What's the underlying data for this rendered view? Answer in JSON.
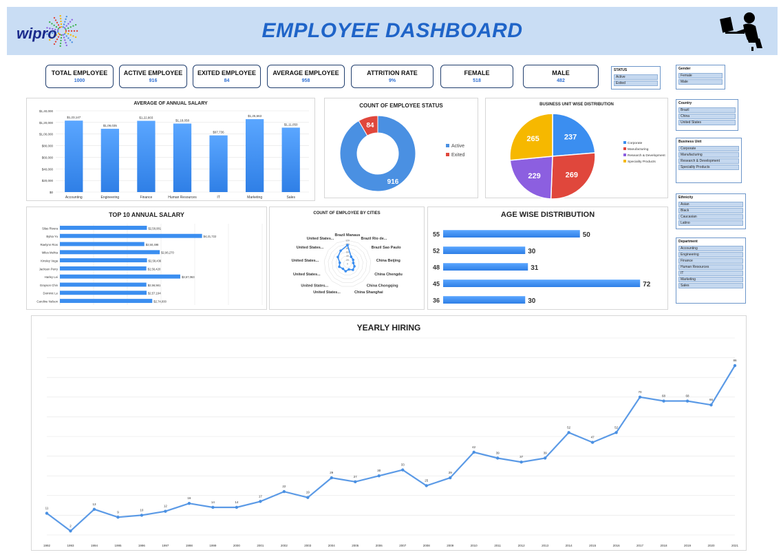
{
  "header": {
    "logo_text": "wipro",
    "title": "EMPLOYEE DASHBOARD"
  },
  "kpis": [
    {
      "label": "TOTAL EMPLOYEE",
      "value": "1000"
    },
    {
      "label": "ACTIVE EMPLOYEE",
      "value": "916"
    },
    {
      "label": "EXITED EMPLOYEE",
      "value": "84"
    },
    {
      "label": "AVERAGE EMPLOYEE",
      "value": "958"
    },
    {
      "label": "ATTRITION RATE",
      "value": "9%"
    },
    {
      "label": "FEMALE",
      "value": "518"
    },
    {
      "label": "MALE",
      "value": "482"
    }
  ],
  "slicers": {
    "status": {
      "title": "STATUS",
      "items": [
        "Active",
        "Exited"
      ]
    },
    "gender": {
      "title": "Gender",
      "items": [
        "Female",
        "Male"
      ]
    },
    "country": {
      "title": "Country",
      "items": [
        "Brazil",
        "China",
        "United States"
      ]
    },
    "business_unit": {
      "title": "Business Unit",
      "items": [
        "Corporate",
        "Manufacturing",
        "Research & Development",
        "Speciality Products"
      ]
    },
    "ethnicity": {
      "title": "Ethnicity",
      "items": [
        "Asian",
        "Black",
        "Caucasian",
        "Latino"
      ]
    },
    "department": {
      "title": "Department",
      "items": [
        "Accounting",
        "Engineering",
        "Finance",
        "Human Resources",
        "IT",
        "Marketing",
        "Sales"
      ]
    }
  },
  "colors": {
    "accent": "#3b8ef0",
    "active": "#4a90e2",
    "exited": "#e0473c",
    "purple": "#8c5fe0",
    "yellow": "#f6b800"
  },
  "chart_data": [
    {
      "type": "bar",
      "title": "AVERAGE OF ANNUAL SALARY",
      "categories": [
        "Accounting",
        "Engineering",
        "Finance",
        "Human Resources",
        "IT",
        "Marketing",
        "Sales"
      ],
      "values": [
        123147,
        109035,
        122803,
        118058,
        97736,
        125663,
        111050
      ],
      "value_labels": [
        "$1,23,147",
        "$1,09,035",
        "$1,22,803",
        "$1,18,058",
        "$97,736",
        "$1,25,663",
        "$1,11,050"
      ],
      "yticks": [
        "$0",
        "$20,000",
        "$40,000",
        "$60,000",
        "$80,000",
        "$1,00,000",
        "$1,20,000",
        "$1,40,000"
      ],
      "ylim": [
        0,
        140000
      ],
      "grid": true
    },
    {
      "type": "pie",
      "title": "COUNT OF EMPLOYEE STATUS",
      "labels": [
        "Active",
        "Exited"
      ],
      "values": [
        916,
        84
      ],
      "legend": "right"
    },
    {
      "type": "pie",
      "title": "BUSINESS UNIT WISE DISTRIBUTION",
      "labels": [
        "Corporate",
        "Manufacturing",
        "Research & Development",
        "Speciality Products"
      ],
      "values": [
        237,
        269,
        229,
        265
      ],
      "legend": "right"
    },
    {
      "type": "bar",
      "title": "TOP 10 ANNUAL SALARY",
      "categories": [
        "Silas Rivera",
        "Bylsa Yu",
        "Raelynn Rios",
        "Miles Mehta",
        "Kinsley Vega",
        "Jackson Perry",
        "Harley Lei",
        "Grayson Chin",
        "Dominic Le",
        "Caroline Nelson"
      ],
      "values": [
        258081,
        421722,
        250498,
        296270,
        258436,
        256420,
        357063,
        256561,
        257194,
        274000
      ],
      "value_labels": [
        "$2,58,081",
        "$4,21,722",
        "$2,50,498",
        "$2,96,270",
        "$2,58,436",
        "$2,56,420",
        "$3,57,063",
        "$2,56,561",
        "$2,57,194",
        "$2,74,000"
      ],
      "xlim": [
        0,
        600000
      ],
      "grid": true
    },
    {
      "type": "scatter",
      "title": "COUNT OF EMPLOYEE BY CITIES",
      "categories": [
        "Brazil Manaus",
        "Brazil Rio de...",
        "Brazil Sao Paulo",
        "China Beijing",
        "China Chengdu",
        "China Chongqing",
        "China Shanghai",
        "United States...",
        "United States...",
        "United States...",
        "United States...",
        "United States...",
        "United States..."
      ],
      "values": [
        95,
        40,
        35,
        30,
        38,
        42,
        30,
        40,
        35,
        45,
        40,
        60,
        75
      ],
      "rticks": [
        "0",
        "20",
        "40",
        "60",
        "80",
        "100",
        "120"
      ],
      "rlim": [
        0,
        120
      ]
    },
    {
      "type": "bar",
      "title": "AGE WISE DISTRIBUTION",
      "categories": [
        "55",
        "52",
        "48",
        "45",
        "36"
      ],
      "values": [
        50,
        30,
        31,
        72,
        30
      ],
      "xlim": [
        0,
        80
      ]
    },
    {
      "type": "line",
      "title": "YEARLY HIRING",
      "x": [
        "1992",
        "1993",
        "1994",
        "1995",
        "1996",
        "1997",
        "1998",
        "1999",
        "2000",
        "2001",
        "2002",
        "2003",
        "2004",
        "2005",
        "2006",
        "2007",
        "2008",
        "2009",
        "2010",
        "2011",
        "2012",
        "2013",
        "2014",
        "2015",
        "2016",
        "2017",
        "2018",
        "2019",
        "2020",
        "2021"
      ],
      "values": [
        11,
        2,
        13,
        9,
        10,
        12,
        16,
        14,
        14,
        17,
        22,
        19,
        29,
        27,
        30,
        33,
        25,
        29,
        42,
        39,
        37,
        39,
        52,
        47,
        52,
        70,
        68,
        68,
        66,
        86
      ],
      "ylim": [
        0,
        100
      ],
      "grid": true
    }
  ]
}
